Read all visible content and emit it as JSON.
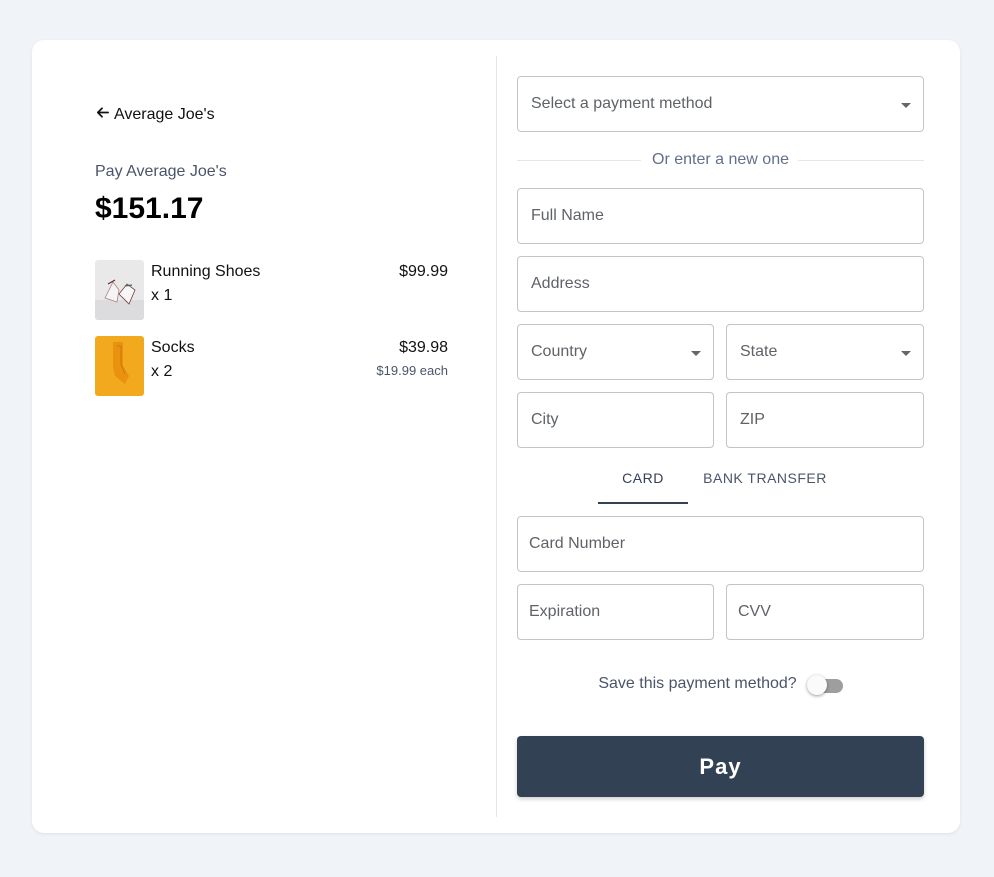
{
  "merchant": {
    "back_label": "Average Joe's",
    "pay_label": "Pay Average Joe's",
    "total": "$151.17"
  },
  "items": [
    {
      "name": "Running Shoes",
      "qty": "x 1",
      "price": "$99.99",
      "each": ""
    },
    {
      "name": "Socks",
      "qty": "x 2",
      "price": "$39.98",
      "each": "$19.99 each"
    }
  ],
  "payment_method": {
    "placeholder": "Select a payment method"
  },
  "divider_text": "Or enter a new one",
  "address": {
    "full_name": "Full Name",
    "address": "Address",
    "country": "Country",
    "state": "State",
    "city": "City",
    "zip": "ZIP"
  },
  "tabs": [
    {
      "label": "CARD",
      "active": true
    },
    {
      "label": "BANK TRANSFER",
      "active": false
    }
  ],
  "card": {
    "number": "Card Number",
    "expiration": "Expiration",
    "cvv": "CVV"
  },
  "save": {
    "label": "Save this payment method?",
    "enabled": false
  },
  "pay_button": "Pay",
  "colors": {
    "accent": "#334155",
    "background": "#f0f3f8"
  },
  "icons": {
    "back": "arrow-left-icon",
    "dropdown": "caret-down-icon"
  }
}
